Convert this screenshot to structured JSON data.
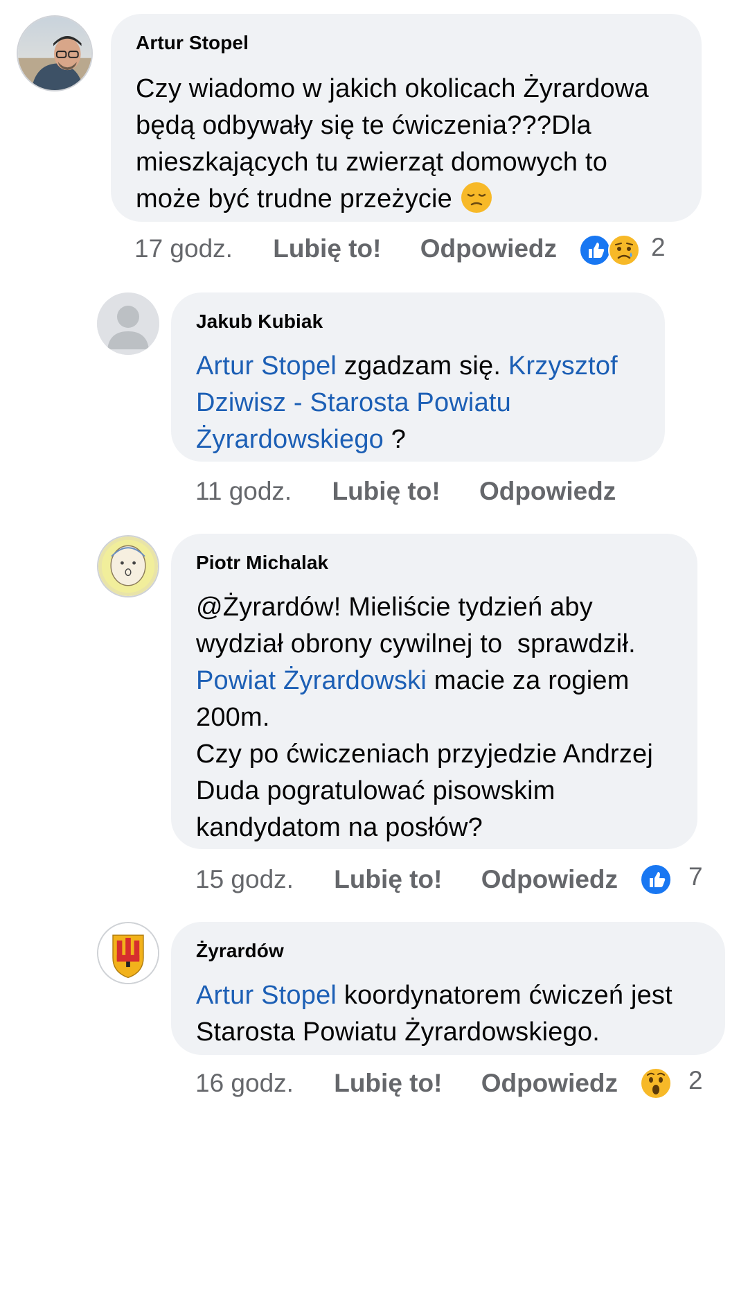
{
  "comments": [
    {
      "author": "Artur Stopel",
      "text_lines": [
        "Czy wiadomo w jakich okolicach Żyrardowa",
        "będą odbywały się te ćwiczenia???Dla",
        "mieszkających tu zwierząt domowych to",
        "może być trudne przeżycie"
      ],
      "emoji": "pensive-face",
      "time": "17 godz.",
      "like_label": "Lubię to!",
      "reply_label": "Odpowiedz",
      "reactions": [
        "like",
        "sad"
      ],
      "reaction_count": "2"
    },
    {
      "author": "Jakub Kubiak",
      "mention1": "Artur Stopel",
      "text_mid": " zgadzam się. ",
      "mention2_line1": "Krzysztof",
      "mention2_line2": "Dziwisz - Starosta Powiatu",
      "mention2_line3": "Żyrardowskiego",
      "text_end": " ?",
      "time": "11 godz.",
      "like_label": "Lubię to!",
      "reply_label": "Odpowiedz"
    },
    {
      "author": "Piotr Michalak",
      "line1": "@Żyrardów! Mieliście tydzień aby",
      "line2": "wydział obrony cywilnej to  sprawdził.",
      "mention": "Powiat Żyrardowski",
      "line3_rest": " macie za rogiem",
      "line4": "200m.",
      "line5": "Czy po ćwiczeniach przyjedzie Andrzej",
      "line6": "Duda pogratulować pisowskim",
      "line7": "kandydatom na posłów?",
      "time": "15 godz.",
      "like_label": "Lubię to!",
      "reply_label": "Odpowiedz",
      "reactions": [
        "like"
      ],
      "reaction_count": "7"
    },
    {
      "author": "Żyrardów",
      "mention": "Artur Stopel",
      "line1_rest": " koordynatorem ćwiczeń jest",
      "line2": "Starosta Powiatu Żyrardowskiego.",
      "time": "16 godz.",
      "like_label": "Lubię to!",
      "reply_label": "Odpowiedz",
      "reactions": [
        "wow"
      ],
      "reaction_count": "2"
    }
  ],
  "colors": {
    "bubble": "#f0f2f5",
    "mention": "#1c5fb5",
    "meta": "#65676b",
    "like_blue": "#1877f2",
    "emoji_yellow": "#f7b928"
  }
}
